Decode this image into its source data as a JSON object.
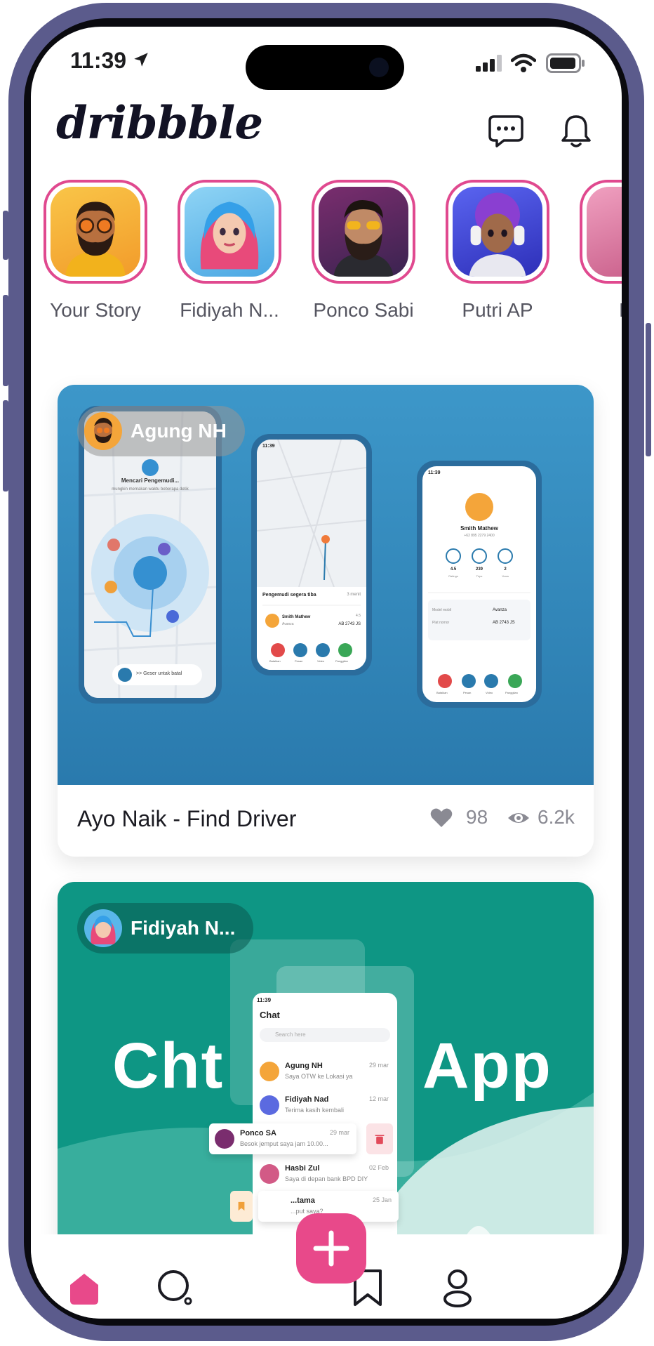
{
  "status_bar": {
    "time": "11:39"
  },
  "header": {
    "logo": "dribbble",
    "chat_icon": "chat-bubble-icon",
    "bell_icon": "bell-icon"
  },
  "stories": [
    {
      "name": "Your Story",
      "avatar_color": "#f4a53a"
    },
    {
      "name": "Fidiyah N...",
      "avatar_color": "#59b7ea"
    },
    {
      "name": "Ponco Sabi",
      "avatar_color": "#7a2d6e"
    },
    {
      "name": "Putri AP",
      "avatar_color": "#3b3fd6"
    },
    {
      "name": "Ha",
      "avatar_color": "#d25a86"
    }
  ],
  "posts": [
    {
      "author": "Agung NH",
      "title": "Ayo Naik - Find Driver",
      "likes": "98",
      "views": "6.2k",
      "preview": {
        "phone1": {
          "time": "",
          "searching": "Mencari Pengemudi...",
          "searching_sub": "mungkin memakan waktu beberapa detik",
          "cancel_hint": ">> Geser untak batal"
        },
        "phone2": {
          "time": "11:39",
          "arrival": "Pengemudi segera tiba",
          "eta": "3 menit",
          "driver_name": "Smith Mathew",
          "driver_area": "Avanza",
          "rating": "4.5",
          "plate": "AB 2743 JS",
          "actions": [
            "Batalkan",
            "Pesan",
            "Video",
            "Panggilan"
          ]
        },
        "phone3": {
          "time": "11:39",
          "driver_name": "Smith Mathew",
          "phone": "+62 895 2279 2400",
          "rating": "4.5",
          "rating_label": "Ratings",
          "trips": "239",
          "trips_label": "Trips",
          "years": "2",
          "years_label": "Years",
          "model_label": "Model mobil",
          "model": "Avanza",
          "plate_label": "Plat nomor",
          "plate": "AB 2743 JS",
          "actions": [
            "Batalkan",
            "Pesan",
            "Video",
            "Panggilan"
          ]
        }
      }
    },
    {
      "author": "Fidiyah N...",
      "title_left": "Cht",
      "title_right": "App",
      "preview": {
        "time": "11:39",
        "heading": "Chat",
        "search_placeholder": "Search here",
        "rows": [
          {
            "name": "Agung NH",
            "msg": "Saya OTW ke Lokasi ya",
            "date": "29 mar"
          },
          {
            "name": "Fidiyah Nad",
            "msg": "Terima kasih kembali",
            "date": "12 mar"
          },
          {
            "name": "Ponco SA",
            "msg": "Besok jemput saya jam 10.00...",
            "date": "29 mar"
          },
          {
            "name": "Hasbi Zul",
            "msg": "Saya di depan bank BPD DIY",
            "date": "02 Feb"
          },
          {
            "name": "...tama",
            "msg": "...put saya?",
            "date": "25 Jan"
          }
        ]
      }
    }
  ],
  "nav": {
    "home": "home-icon",
    "search": "search-icon",
    "add": "plus-icon",
    "saved": "bookmark-icon",
    "profile": "profile-icon"
  },
  "colors": {
    "accent": "#e8498a",
    "card1_bg": "#3d97c9",
    "card2_bg": "#0e9684",
    "phone_frame": "#5b5b8c"
  }
}
